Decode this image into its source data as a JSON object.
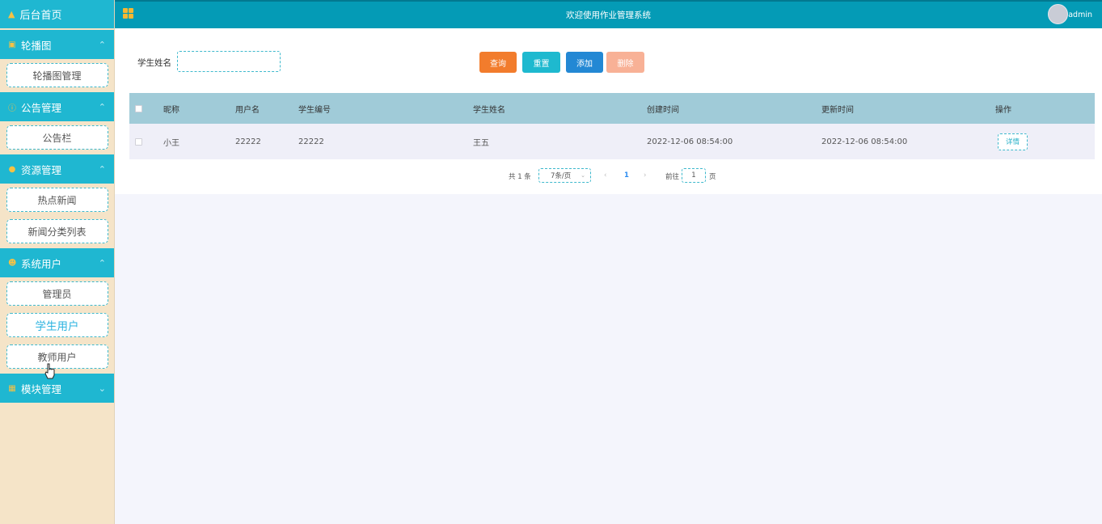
{
  "sidebar": {
    "home": "后台首页",
    "groups": [
      {
        "label": "轮播图",
        "items": [
          "轮播图管理"
        ]
      },
      {
        "label": "公告管理",
        "items": [
          "公告栏"
        ]
      },
      {
        "label": "资源管理",
        "items": [
          "热点新闻",
          "新闻分类列表"
        ]
      },
      {
        "label": "系统用户",
        "items": [
          "管理员",
          "学生用户",
          "教师用户"
        ]
      },
      {
        "label": "模块管理",
        "items": []
      }
    ]
  },
  "header": {
    "title": "欢迎使用作业管理系统",
    "user": "admin"
  },
  "search": {
    "label": "学生姓名",
    "value": ""
  },
  "buttons": {
    "query": "查询",
    "reset": "重置",
    "add": "添加",
    "delete": "删除"
  },
  "table": {
    "columns": [
      "昵称",
      "用户名",
      "学生编号",
      "学生姓名",
      "创建时间",
      "更新时间",
      "操作"
    ],
    "rows": [
      {
        "nickname": "小王",
        "username": "22222",
        "student_no": "22222",
        "student_name": "王五",
        "created": "2022-12-06 08:54:00",
        "updated": "2022-12-06 08:54:00",
        "action": "详情"
      }
    ]
  },
  "pagination": {
    "total": "共 1 条",
    "page_size": "7条/页",
    "current": "1",
    "goto_label": "前往",
    "goto_value": "1",
    "page_suffix": "页"
  },
  "colors": {
    "header_bar": "#049bb6",
    "menu_head": "#1fb7d1",
    "sidebar_bg": "#f5e4c8",
    "query": "#f27c2c",
    "reset": "#1eb9cf",
    "add": "#2388d4",
    "delete": "#f8b196"
  }
}
